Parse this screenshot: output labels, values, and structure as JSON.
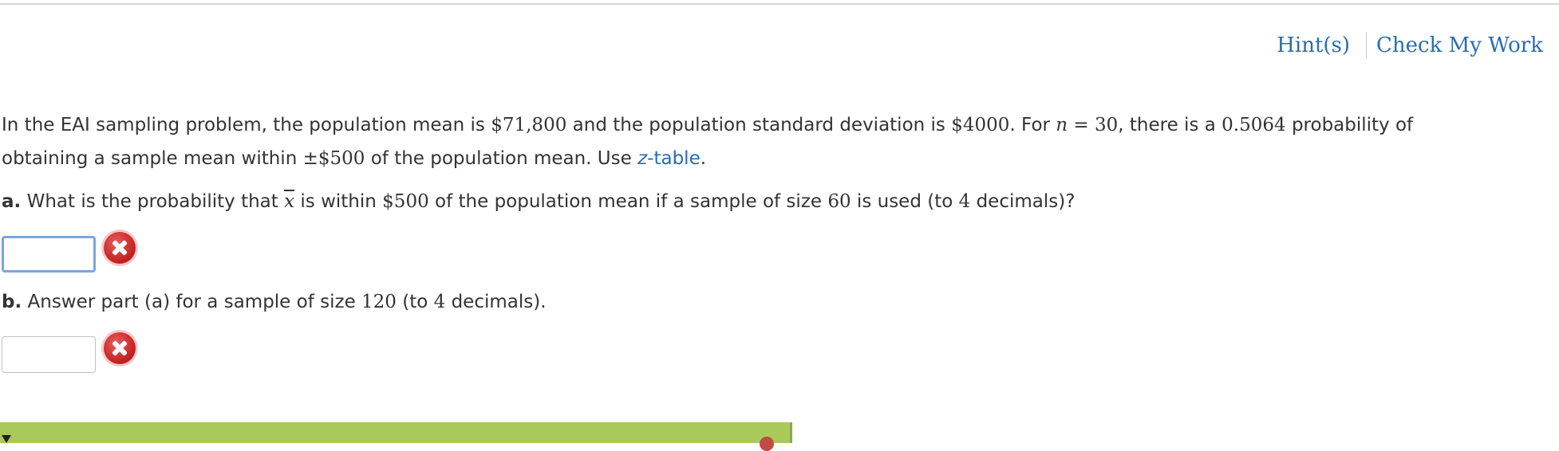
{
  "toolbar": {
    "hint_label": "Hint(s)",
    "check_label": "Check My Work"
  },
  "problem": {
    "intro_1": "In the EAI sampling problem, the population mean is ",
    "mean": "$71,800",
    "intro_2": " and the population standard deviation is ",
    "sd": "$4000",
    "intro_3": ". For ",
    "n_var": "n",
    "n_eq": " = 30",
    "intro_4": ", there is a ",
    "prob": "0.5064",
    "intro_5": " probability of",
    "line2_1": "obtaining a sample mean within ",
    "pm": "±$500",
    "line2_2": " of the population mean. Use ",
    "table_link": "z",
    "table_link_rest": "-table",
    "line2_end": "."
  },
  "part_a": {
    "label": "a.",
    "text_1": " What is the probability that ",
    "xbar": "x",
    "text_2": " is within ",
    "amount": "$500",
    "text_3": " of the population mean if a sample of size ",
    "size": "60",
    "text_4": " is used (to ",
    "decimals": "4",
    "text_5": " decimals)?",
    "value": ""
  },
  "part_b": {
    "label": "b.",
    "text_1": " Answer part (a) for a sample of size ",
    "size": "120",
    "text_2": " (to ",
    "decimals": "4",
    "text_3": " decimals).",
    "value": ""
  },
  "icons": {
    "error": "error-x-icon",
    "collapse": "triangle-down-icon"
  },
  "colors": {
    "link": "#2b6cb0",
    "error": "#c21d1d",
    "feedback_bar": "#a9c95a"
  }
}
